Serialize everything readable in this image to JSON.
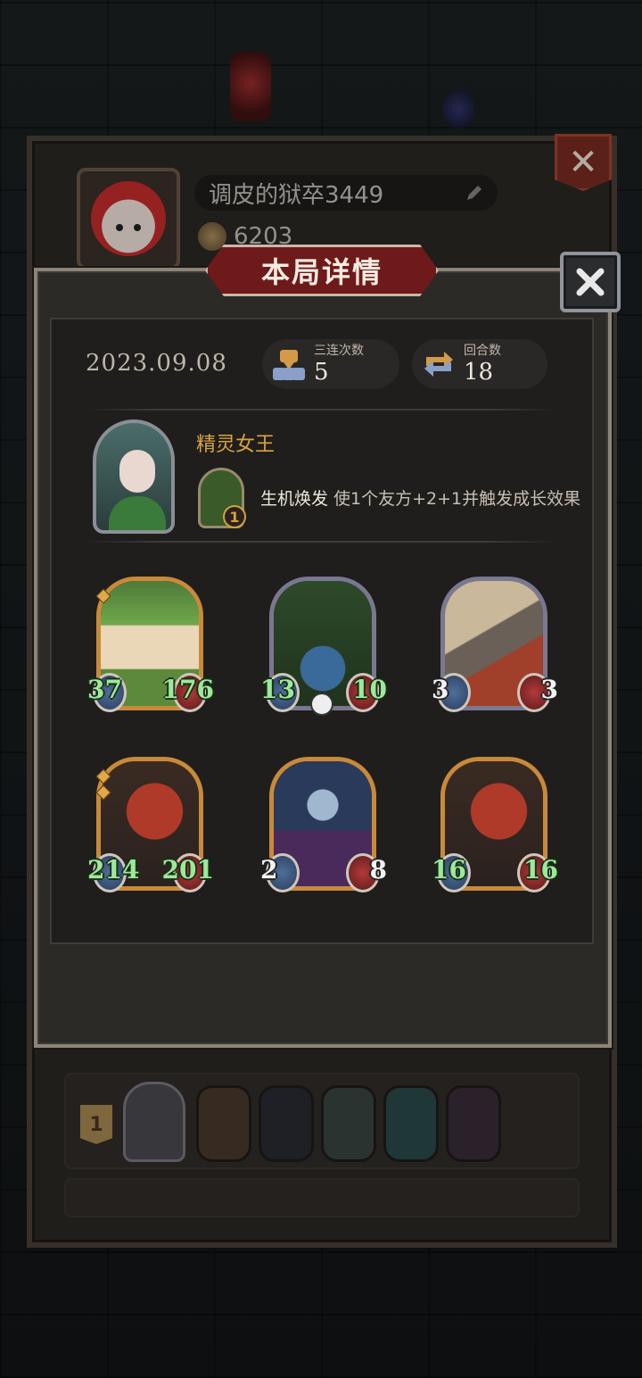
{
  "player": {
    "name": "调皮的狱卒3449",
    "coins": "6203"
  },
  "modal": {
    "title": "本局详情",
    "date": "2023.09.08",
    "stats": [
      {
        "label": "三连次数",
        "value": "5"
      },
      {
        "label": "回合数",
        "value": "18"
      }
    ],
    "hero": {
      "name": "精灵女王",
      "skill_level": "1",
      "skill_name": "生机焕发",
      "skill_desc": "使1个友方+2+1并触发成长效果"
    },
    "units": [
      {
        "atk": "37",
        "hp": "176",
        "frame": "gold",
        "stars": 1,
        "art": "leaf-sprout"
      },
      {
        "atk": "13",
        "hp": "10",
        "frame": "silver",
        "stars": 0,
        "art": "vine-creature",
        "deathrattle": true
      },
      {
        "atk": "3",
        "hp": "3",
        "frame": "silver",
        "stars": 0,
        "art": "rocket-cart",
        "white_numbers": true
      },
      {
        "atk": "214",
        "hp": "201",
        "frame": "gold",
        "stars": 2,
        "art": "red-dragon"
      },
      {
        "atk": "2",
        "hp": "8",
        "frame": "gold",
        "stars": 0,
        "art": "blue-elf-witch",
        "white_numbers": true
      },
      {
        "atk": "16",
        "hp": "16",
        "frame": "gold",
        "stars": 0,
        "art": "red-dragon"
      }
    ]
  },
  "history": {
    "rows": [
      {
        "rank": "1"
      }
    ]
  },
  "icons": {
    "edit": "pencil-icon",
    "coin": "coin-icon",
    "triple": "triple-icon",
    "round": "cycle-icon",
    "close": "close-icon",
    "deathrattle": "skull-icon"
  },
  "colors": {
    "title_bg": "#6e1a1a",
    "hero_name": "#d9a441",
    "buff_number": "#9ee89a",
    "gold_frame": "#c88a3a",
    "silver_frame": "#7a7890"
  }
}
